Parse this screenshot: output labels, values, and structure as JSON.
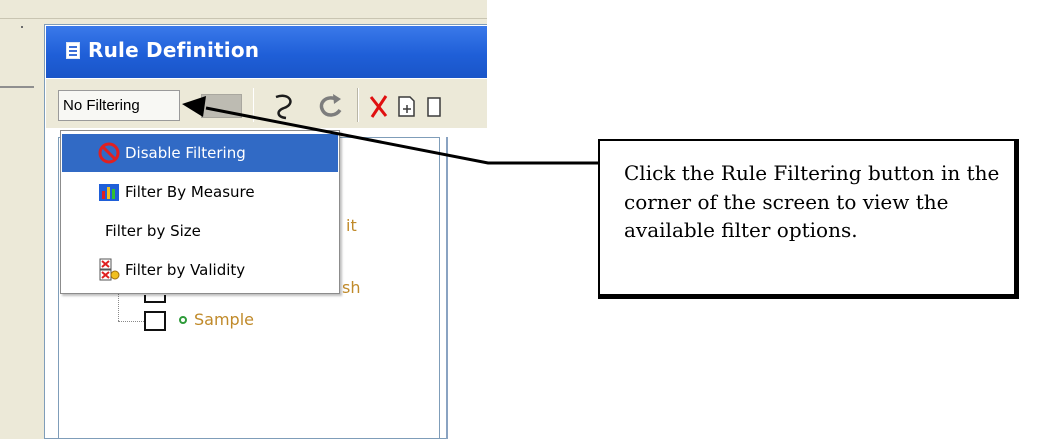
{
  "window": {
    "title": "Rule Definition"
  },
  "toolbar": {
    "filter_button_label": "No Filtering",
    "icons": [
      "disabled-button-icon",
      "undo-icon",
      "redo-icon",
      "delete-icon",
      "new-rule-icon",
      "copy-rule-icon"
    ]
  },
  "filter_menu": {
    "items": [
      {
        "label": "Disable Filtering",
        "icon": "no-entry-icon",
        "selected": true
      },
      {
        "label": "Filter By Measure",
        "icon": "bar-chart-icon",
        "selected": false
      },
      {
        "label": "Filter by Size",
        "icon": "",
        "selected": false
      },
      {
        "label": "Filter by Validity",
        "icon": "validity-icon",
        "selected": false
      }
    ]
  },
  "tree": {
    "visible_fragments": [
      "it",
      "sh"
    ],
    "items": [
      {
        "label": "Sample"
      }
    ]
  },
  "callout": {
    "text": "Click the Rule Filtering button in the corner of the screen to view the available filter options."
  },
  "colors": {
    "titlebar": "#2a69e2",
    "menu_highlight": "#316ac5",
    "tree_text": "#c08a2a",
    "window_bg": "#ece9d8"
  }
}
